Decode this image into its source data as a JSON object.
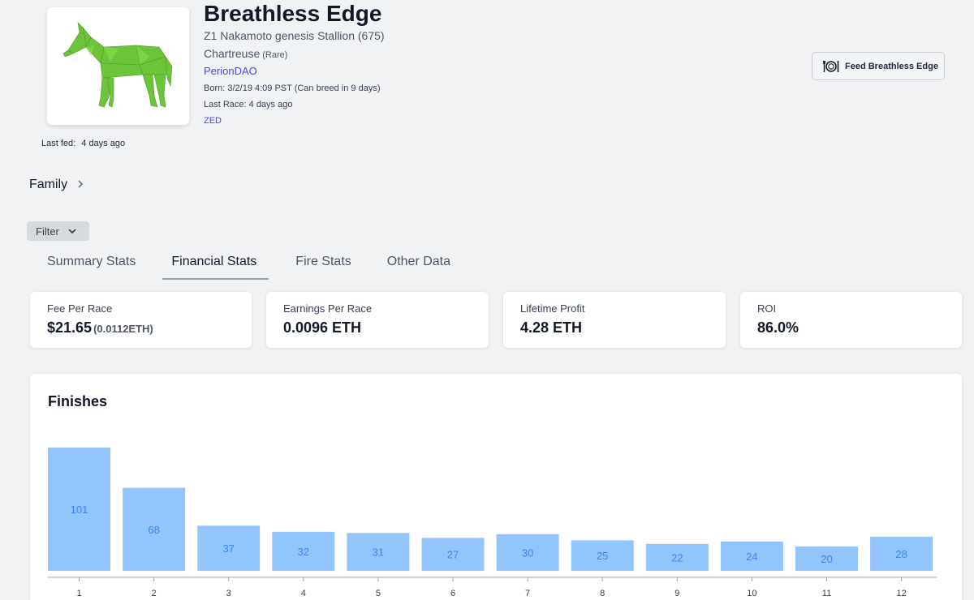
{
  "horse": {
    "name": "Breathless Edge",
    "subtitle": "Z1 Nakamoto genesis Stallion (675)",
    "color": "Chartreuse",
    "rarity": "(Rare)",
    "owner": "PerionDAO",
    "born": "Born: 3/2/19 4:09 PST (Can breed in 9 days)",
    "last_race": "Last Race: 4 days ago",
    "zed_link": "ZED",
    "last_fed_label": "Last fed:",
    "last_fed_value": "4 days ago",
    "image_icon": "horse-icon",
    "image_color": "#6cc43a"
  },
  "feed_button": {
    "label": "Feed Breathless Edge",
    "icon": "plate-cutlery-icon"
  },
  "family": {
    "label": "Family",
    "icon": "chevron-right-icon"
  },
  "filter": {
    "label": "Filter",
    "icon": "chevron-down-icon"
  },
  "tabs": [
    {
      "label": "Summary Stats",
      "active": false
    },
    {
      "label": "Financial Stats",
      "active": true
    },
    {
      "label": "Fire Stats",
      "active": false
    },
    {
      "label": "Other Data",
      "active": false
    }
  ],
  "stats": [
    {
      "label": "Fee Per Race",
      "value": "$21.65",
      "sub": "(0.0112ETH)"
    },
    {
      "label": "Earnings Per Race",
      "value": "0.0096 ETH"
    },
    {
      "label": "Lifetime Profit",
      "value": "4.28 ETH"
    },
    {
      "label": "ROI",
      "value": "86.0%"
    }
  ],
  "finishes": {
    "title": "Finishes"
  },
  "colors": {
    "accent": "#4f46e5",
    "bar_fill": "#93c5fd",
    "bar_label": "#3b82f6"
  },
  "chart_data": {
    "type": "bar",
    "title": "Finishes",
    "categories": [
      "1",
      "2",
      "3",
      "4",
      "5",
      "6",
      "7",
      "8",
      "9",
      "10",
      "11",
      "12"
    ],
    "values": [
      101,
      68,
      37,
      32,
      31,
      27,
      30,
      25,
      22,
      24,
      20,
      28
    ],
    "ylim": [
      0,
      101
    ],
    "grid": false,
    "xlabel": "",
    "ylabel": ""
  }
}
